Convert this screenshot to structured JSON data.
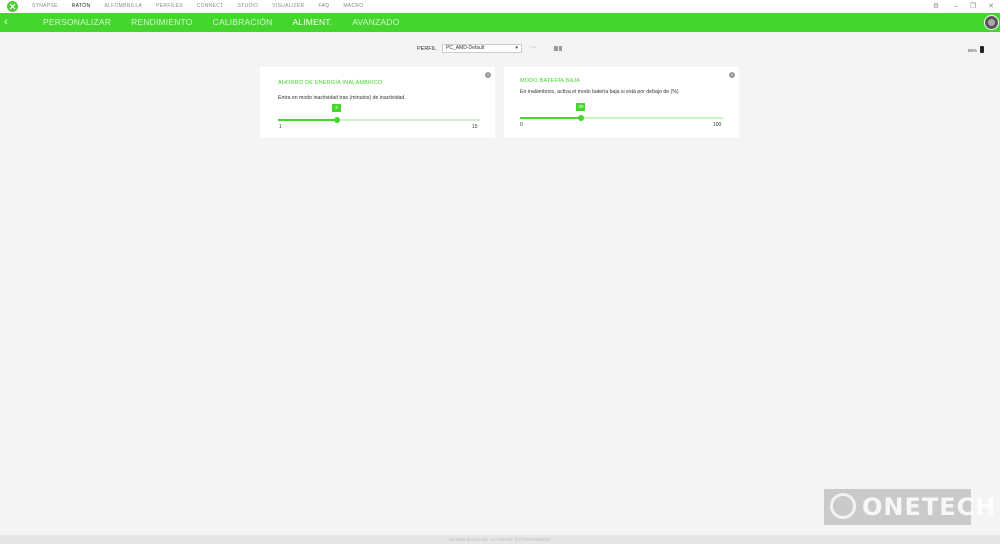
{
  "topnav": {
    "items": [
      {
        "label": "SYNAPSE",
        "active": false
      },
      {
        "label": "RATÓN",
        "active": true
      },
      {
        "label": "ALFOMBRILLA",
        "active": false
      },
      {
        "label": "PERFILES",
        "active": false
      },
      {
        "label": "CONNECT",
        "active": false
      },
      {
        "label": "STUDIO",
        "active": false
      },
      {
        "label": "VISUALIZER",
        "active": false
      },
      {
        "label": "FAQ",
        "active": false
      },
      {
        "label": "MACRO",
        "active": false
      }
    ]
  },
  "window_controls": {
    "settings": "⚙",
    "minimize": "–",
    "maximize": "❐",
    "close": "✕"
  },
  "tabs": [
    {
      "label": "PERSONALIZAR",
      "active": false
    },
    {
      "label": "RENDIMIENTO",
      "active": false
    },
    {
      "label": "CALIBRACIÓN",
      "active": false
    },
    {
      "label": "ALIMENT.",
      "active": true
    },
    {
      "label": "AVANZADO",
      "active": false
    }
  ],
  "back_icon": "‹",
  "profile": {
    "label": "PERFIL",
    "value": "PC_AMD-Default",
    "more": "···"
  },
  "battery": {
    "percent": "86%"
  },
  "cards": {
    "energy": {
      "title": "AHORRO DE ENERGÍA INALÁMBRICO",
      "description": "Entra en modo inactividad tras (minutos) de inactividad.",
      "value": "5",
      "min": "1",
      "max": "15",
      "fraction": 0.29
    },
    "lowbattery": {
      "title": "MODO BATERÍA BAJA",
      "description": "En inalámbrico, activa el modo batería baja si está por debajo de (%)",
      "value": "30",
      "min": "0",
      "max": "100",
      "fraction": 0.3
    }
  },
  "info_glyph": "?",
  "watermark": {
    "text": "ONETECH"
  },
  "footer": {
    "text": "RAZER BASILISK ULTIMATE (HYPERSPEED)"
  },
  "colors": {
    "accent": "#44d62c",
    "track": "#cdf3c6"
  }
}
